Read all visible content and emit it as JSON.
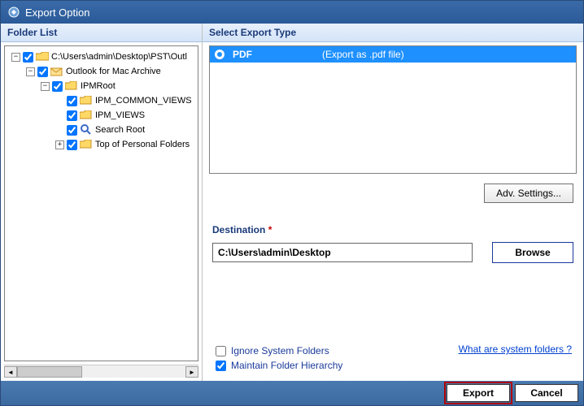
{
  "titlebar": {
    "title": "Export Option"
  },
  "left_panel": {
    "header": "Folder List",
    "tree": {
      "root": {
        "label": "C:\\Users\\admin\\Desktop\\PST\\Outl",
        "checked": true,
        "expanded": true
      },
      "outlook": {
        "label": "Outlook for Mac Archive",
        "checked": true,
        "expanded": true
      },
      "ipmroot": {
        "label": "IPMRoot",
        "checked": true,
        "expanded": true
      },
      "common": {
        "label": "IPM_COMMON_VIEWS",
        "checked": true
      },
      "views": {
        "label": "IPM_VIEWS",
        "checked": true
      },
      "search": {
        "label": "Search Root",
        "checked": true
      },
      "top": {
        "label": "Top of Personal Folders",
        "checked": true,
        "expanded": false
      }
    }
  },
  "right_panel": {
    "header": "Select Export Type",
    "export_item": {
      "name": "PDF",
      "desc": "(Export as .pdf file)",
      "selected": true
    },
    "adv_settings": "Adv. Settings...",
    "destination": {
      "label": "Destination",
      "required": "*",
      "value": "C:\\Users\\admin\\Desktop",
      "browse": "Browse"
    },
    "options": {
      "ignore": {
        "label": "Ignore System Folders",
        "checked": false
      },
      "maintain": {
        "label": "Maintain Folder Hierarchy",
        "checked": true
      }
    },
    "system_link": "What are system folders ?"
  },
  "footer": {
    "export": "Export",
    "cancel": "Cancel"
  }
}
